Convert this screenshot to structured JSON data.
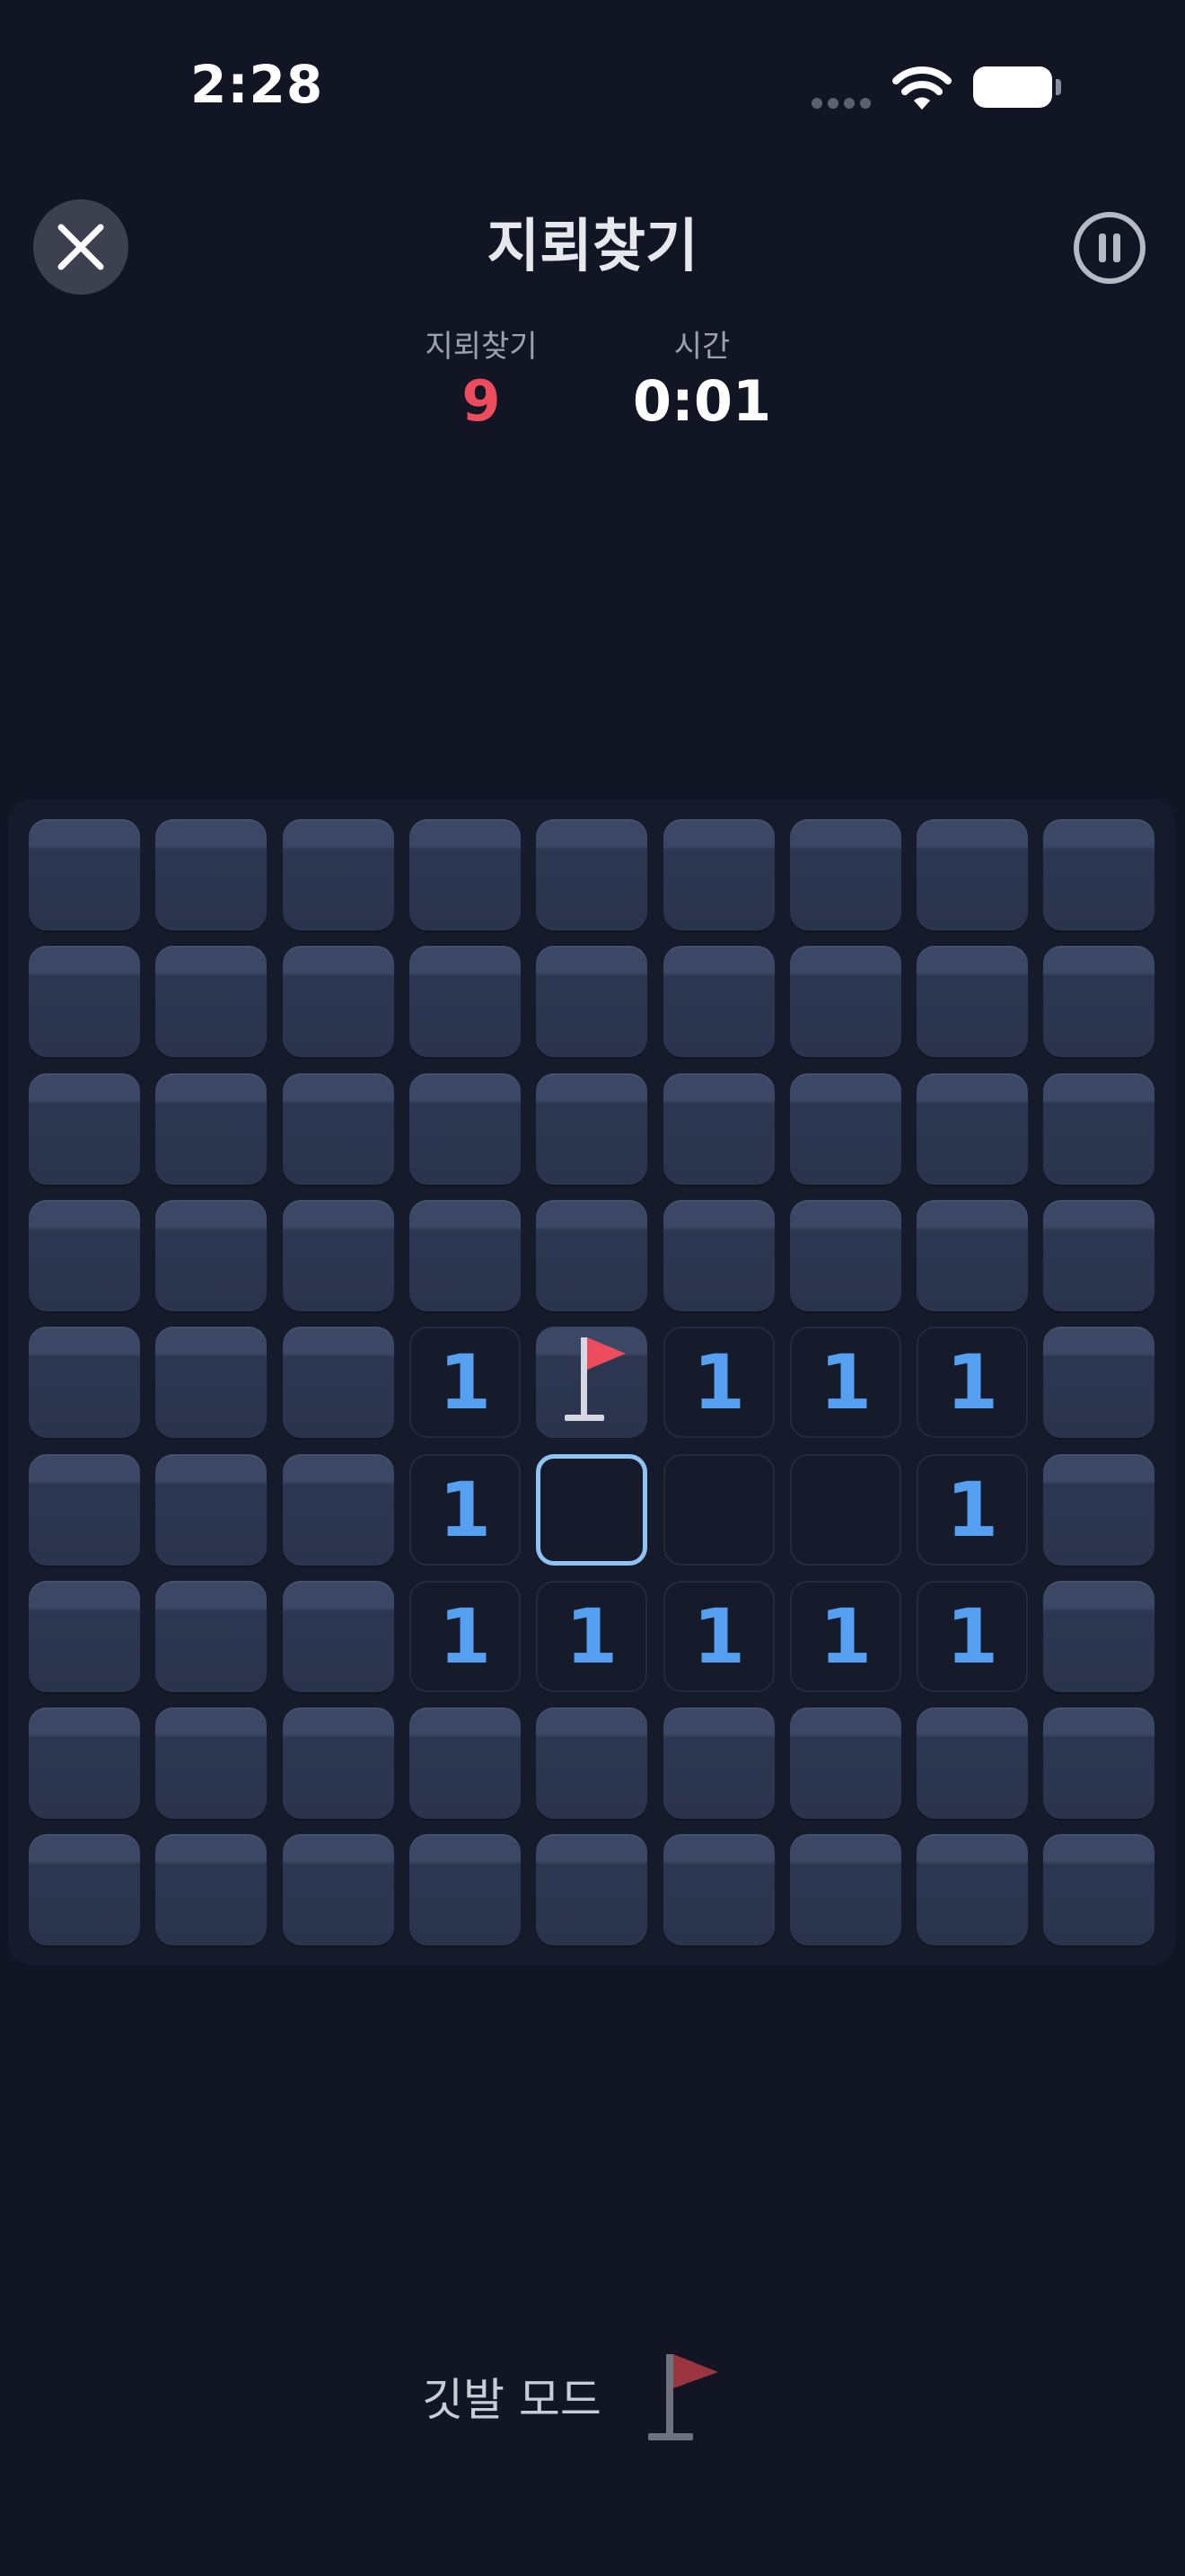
{
  "status_bar": {
    "time": "2:28"
  },
  "header": {
    "title": "지뢰찾기",
    "close_icon": "close-icon",
    "pause_icon": "pause-icon"
  },
  "stats": {
    "mines_label": "지뢰찾기",
    "mines_value": "9",
    "time_label": "시간",
    "time_value": "0:01"
  },
  "board": {
    "rows": 9,
    "cols": 9,
    "cells": [
      [
        "h",
        "h",
        "h",
        "h",
        "h",
        "h",
        "h",
        "h",
        "h"
      ],
      [
        "h",
        "h",
        "h",
        "h",
        "h",
        "h",
        "h",
        "h",
        "h"
      ],
      [
        "h",
        "h",
        "h",
        "h",
        "h",
        "h",
        "h",
        "h",
        "h"
      ],
      [
        "h",
        "h",
        "h",
        "h",
        "h",
        "h",
        "h",
        "h",
        "h"
      ],
      [
        "h",
        "h",
        "h",
        "1",
        "f",
        "1",
        "1",
        "1",
        "h"
      ],
      [
        "h",
        "h",
        "h",
        "1",
        "0",
        "0",
        "0",
        "1",
        "h"
      ],
      [
        "h",
        "h",
        "h",
        "1",
        "1",
        "1",
        "1",
        "1",
        "h"
      ],
      [
        "h",
        "h",
        "h",
        "h",
        "h",
        "h",
        "h",
        "h",
        "h"
      ],
      [
        "h",
        "h",
        "h",
        "h",
        "h",
        "h",
        "h",
        "h",
        "h"
      ]
    ],
    "selected": [
      5,
      4
    ],
    "colors": {
      "number": "#56a0f2",
      "flag": "#ec4c5c",
      "selected_border": "#8ec4f4"
    }
  },
  "footer": {
    "flag_mode_label": "깃발 모드",
    "flag_mode_icon": "flag-icon"
  }
}
